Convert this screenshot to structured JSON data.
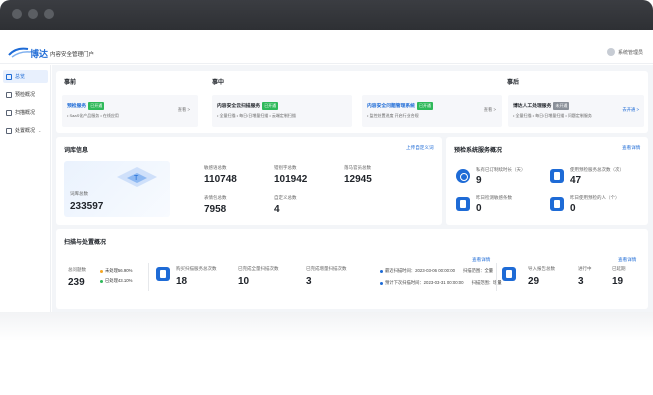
{
  "header": {
    "brand": "博达",
    "subtitle": "内容安全管理门户",
    "user": "系统管理员"
  },
  "sidebar": {
    "items": [
      {
        "label": "总览"
      },
      {
        "label": "预检概况"
      },
      {
        "label": "扫描概况"
      },
      {
        "label": "处置概况"
      }
    ]
  },
  "phases": {
    "before": "事前",
    "during": "事中",
    "after": "事后",
    "more_label": "查看",
    "open_label": "去开通",
    "service1": {
      "name": "预检服务",
      "tag": "已开通",
      "desc": "• SaaS化产品服务 • 在线应用"
    },
    "service2": {
      "name": "内容安全云扫描服务",
      "tag": "已开通",
      "desc": "• 全量扫描 • 每日/日增量扫描 • 云端定制扫描"
    },
    "service3": {
      "name": "内容安全问题管理系统",
      "tag": "已开通",
      "desc": "• 监控处置进度 开启行业合规"
    },
    "service4": {
      "name": "博达人工处理服务",
      "tag": "未开通",
      "desc": "• 全量扫描 • 每日/日增量扫描 • 问题定制服务"
    }
  },
  "lexicon": {
    "title": "词库信息",
    "link": "上传自定义词",
    "total_label": "词库总数",
    "total_value": "233597",
    "stats": [
      {
        "label": "敏感语总数",
        "value": "110748"
      },
      {
        "label": "错别字总数",
        "value": "101942"
      },
      {
        "label": "落马官员总数",
        "value": "12945"
      },
      {
        "label": "表情包总数",
        "value": "7958"
      },
      {
        "label": "自定义总数",
        "value": "4"
      }
    ]
  },
  "precheck": {
    "title": "预检系统服务概况",
    "link": "查看详情",
    "stats": [
      {
        "label": "私有已订制续时长（天）",
        "value": "9"
      },
      {
        "label": "使用预检服务总次数（次）",
        "value": "47"
      },
      {
        "label": "昨日检测敏感条数",
        "value": "0"
      },
      {
        "label": "昨日使用预检的人（个）",
        "value": "0"
      }
    ]
  },
  "scan": {
    "title": "扫描与处置概况",
    "link1": "查看详情",
    "link2": "查看详情",
    "total_label": "总问题数",
    "total_value": "239",
    "unprocessed": "未处理56.90%",
    "processed": "已处理43.10%",
    "items": [
      {
        "label": "购买扫描服务总次数",
        "value": "18"
      },
      {
        "label": "已完成全量扫描次数",
        "value": "10"
      },
      {
        "label": "已完成增量扫描次数",
        "value": "3"
      }
    ],
    "last_scan": "最近扫描时间：2023-03-06 00:00:00",
    "scan_scope_1": "扫描范围：全量",
    "next_scan": "预计下次扫描时间：2023-03-31 00:00:00",
    "scan_scope_2": "扫描范围：增量",
    "dispose": [
      {
        "label": "导入报告总数",
        "value": "29"
      },
      {
        "label": "进行中",
        "value": "3"
      },
      {
        "label": "已延期",
        "value": "19"
      }
    ]
  },
  "colors": {
    "accent": "#1e6bd6",
    "green": "#2fb95a",
    "orange": "#f5a623"
  }
}
